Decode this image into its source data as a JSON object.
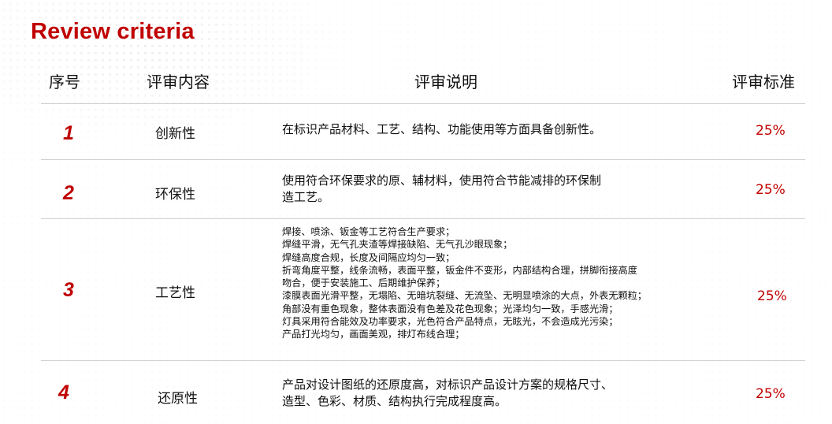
{
  "title": "Review criteria",
  "headers": {
    "index": "序号",
    "content": "评审内容",
    "description": "评审说明",
    "standard": "评审标准"
  },
  "rows": [
    {
      "index": "1",
      "name": "创新性",
      "description": "在标识产品材料、工艺、结构、功能使用等方面具备创新性。",
      "standard": "25%"
    },
    {
      "index": "2",
      "name": "环保性",
      "description_lines": [
        "使用符合环保要求的原、辅材料，使用符合节能减排的环保制",
        "造工艺。"
      ],
      "standard": "25%"
    },
    {
      "index": "3",
      "name": "工艺性",
      "description_lines": [
        "焊接、喷涂、钣金等工艺符合生产要求；",
        "焊缝平滑，无气孔夹渣等焊接缺陷、无气孔沙眼现象；",
        "焊缝高度合规，长度及间隔应均匀一致；",
        "折弯角度平整，线条流畅，表面平整，钣金件不变形，内部结构合理，拼脚衔接高度",
        "吻合，便于安装施工、后期维护保养；",
        "漆膜表面光滑平整，无塌陷、无暗坑裂缝、无流坠、无明显喷涂的大点，外表无颗粒；",
        "角部没有重色现象，整体表面没有色差及花色现象；光泽均匀一致，手感光滑；",
        "灯具采用符合能效及功率要求，光色符合产品特点，无眩光，不会造成光污染；",
        "产品打光均匀，画面美观，排灯布线合理；"
      ],
      "standard": "25%"
    },
    {
      "index": "4",
      "name": "还原性",
      "description_lines": [
        "产品对设计图纸的还原度高，对标识产品设计方案的规格尺寸、",
        "造型、色彩、材质、结构执行完成程度高。"
      ],
      "standard": "25%"
    }
  ],
  "colors": {
    "accent": "#c00000",
    "rule": "#d2d2d2",
    "text": "#111111"
  }
}
